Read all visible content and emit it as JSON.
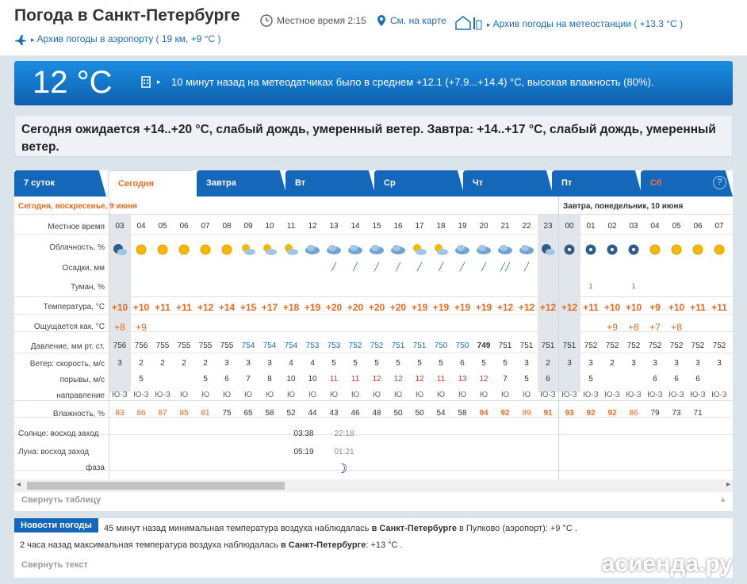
{
  "header": {
    "title": "Погода в Санкт-Петербурге",
    "local_time": "Местное время  2:15",
    "map_link": "См. на карте",
    "archive_station": "Архив погоды на метеостанции ( +13.3 °С )",
    "archive_airport": "Архив погоды в аэропорту ( 19 км, +9 °С )"
  },
  "current": {
    "temp": "12 °С",
    "text": "10 минут назад на метеодатчиках было в среднем +12.1 (+7.9...+14.4) °С, высокая влажность (80%)."
  },
  "forecast_text": "Сегодня ожидается +14..+20 °С, слабый дождь, умеренный ветер. Завтра: +14..+17 °С, слабый дождь, умеренный ветер.",
  "tabs": [
    "7 суток",
    "Сегодня",
    "Завтра",
    "Вт",
    "Ср",
    "Чт",
    "Пт",
    "Сб"
  ],
  "help": "?",
  "dates": {
    "today": "Сегодня, воскресенье, 9 июня",
    "tomorrow": "Завтра, понедельник, 10 июня"
  },
  "labels": {
    "time": "Местное время",
    "clouds": "Облачность, %",
    "precip": "Осадки, мм",
    "fog": "Туман, %",
    "temp": "Температура, °С",
    "feels": "Ощущается как, °С",
    "pressure": "Давление, мм рт. ст.",
    "wind": "Ветер: скорость, м/с",
    "gusts": "порывы, м/с",
    "direction": "направление",
    "humidity": "Влажность, %",
    "sun": "Солнце: восход заход",
    "moon": "Луна: восход заход",
    "phase": "фаза"
  },
  "hours": [
    "03",
    "04",
    "05",
    "06",
    "07",
    "08",
    "09",
    "10",
    "11",
    "12",
    "13",
    "14",
    "15",
    "16",
    "17",
    "18",
    "19",
    "20",
    "21",
    "22",
    "23",
    "00",
    "01",
    "02",
    "03",
    "04",
    "05",
    "06",
    "07"
  ],
  "icons": [
    "night-cloud",
    "sun",
    "sun",
    "sun",
    "sun",
    "sun",
    "sun-cloud",
    "sun-cloud",
    "sun-cloud",
    "cloud",
    "cloud",
    "cloud",
    "cloud",
    "cloud",
    "sun-cloud",
    "sun-cloud",
    "cloud",
    "cloud",
    "cloud",
    "cloud",
    "night-cloud",
    "night",
    "night",
    "night",
    "night",
    "sun",
    "sun",
    "sun",
    "sun"
  ],
  "rain": [
    "",
    "",
    "",
    "",
    "",
    "",
    "",
    "",
    "",
    "",
    "r",
    "r",
    "r",
    "r",
    "r",
    "r",
    "r",
    "r",
    "rr",
    "r",
    "",
    "",
    "",
    "",
    "",
    "",
    "",
    "",
    ""
  ],
  "fog": [
    "",
    "",
    "",
    "",
    "",
    "",
    "",
    "",
    "",
    "",
    "",
    "",
    "",
    "",
    "",
    "",
    "",
    "",
    "",
    "",
    "",
    "",
    "1",
    "",
    "1",
    "",
    "",
    "",
    ""
  ],
  "temps": [
    "+10",
    "+10",
    "+11",
    "+11",
    "+12",
    "+14",
    "+15",
    "+17",
    "+18",
    "+19",
    "+20",
    "+20",
    "+20",
    "+20",
    "+19",
    "+19",
    "+19",
    "+19",
    "+12",
    "+12",
    "+12",
    "+12",
    "+11",
    "+10",
    "+10",
    "+9",
    "+10",
    "+11",
    "+11"
  ],
  "feels": [
    "+8",
    "+9",
    "",
    "",
    "",
    "",
    "",
    "",
    "",
    "",
    "",
    "",
    "",
    "",
    "",
    "",
    "",
    "",
    "",
    "",
    "",
    "",
    "",
    "+9",
    "+8",
    "+7",
    "+8",
    "",
    ""
  ],
  "pressure": [
    "756",
    "756",
    "755",
    "755",
    "755",
    "755",
    "754",
    "754",
    "754",
    "753",
    "753",
    "752",
    "752",
    "751",
    "751",
    "750",
    "750",
    "749",
    "751",
    "751",
    "751",
    "751",
    "752",
    "752",
    "752",
    "752",
    "752",
    "752",
    "752"
  ],
  "wind": [
    "3",
    "2",
    "2",
    "2",
    "2",
    "3",
    "3",
    "3",
    "4",
    "4",
    "5",
    "5",
    "5",
    "5",
    "5",
    "5",
    "6",
    "5",
    "5",
    "3",
    "2",
    "3",
    "3",
    "2",
    "3",
    "3",
    "3",
    "3",
    "3"
  ],
  "gusts": [
    "",
    "5",
    "",
    "",
    "5",
    "6",
    "7",
    "8",
    "10",
    "10",
    "11",
    "11",
    "12",
    "12",
    "12",
    "11",
    "13",
    "12",
    "7",
    "5",
    "6",
    "",
    "5",
    "",
    "",
    "6",
    "6",
    "6",
    ""
  ],
  "dirs": [
    "Ю-З",
    "Ю-З",
    "Ю-З",
    "Ю",
    "Ю",
    "Ю",
    "Ю",
    "Ю",
    "Ю",
    "Ю",
    "Ю",
    "Ю",
    "Ю",
    "Ю",
    "Ю",
    "Ю",
    "Ю",
    "Ю",
    "Ю",
    "Ю",
    "Ю-З",
    "Ю-З",
    "Ю-З",
    "Ю-З",
    "Ю-З",
    "Ю-З",
    "Ю-З",
    "Ю-З",
    "Ю-З"
  ],
  "humidity": [
    "83",
    "86",
    "87",
    "85",
    "81",
    "75",
    "65",
    "58",
    "52",
    "44",
    "43",
    "46",
    "48",
    "50",
    "50",
    "54",
    "58",
    "94",
    "92",
    "89",
    "91",
    "93",
    "92",
    "92",
    "86",
    "79",
    "73",
    "71",
    ""
  ],
  "sun": {
    "rise": "03:38",
    "set": "22:18"
  },
  "moon": {
    "rise": "05:19",
    "set": "01:21"
  },
  "collapse_table": "Свернуть таблицу",
  "news": {
    "button": "Новости погоды",
    "line1_prefix": "45 минут назад минимальная температура воздуха наблюдалась ",
    "line1_city": "в Санкт-Петербурге",
    "line1_suffix": " в Пулково (аэропорт): +9 °С .",
    "line2_prefix": "2 часа назад максимальная температура воздуха наблюдалась ",
    "line2_city": "в Санкт-Петербурге",
    "line2_suffix": ": +13 °С .",
    "collapse": "Свернуть текст"
  },
  "logo": "асиенда.ру"
}
